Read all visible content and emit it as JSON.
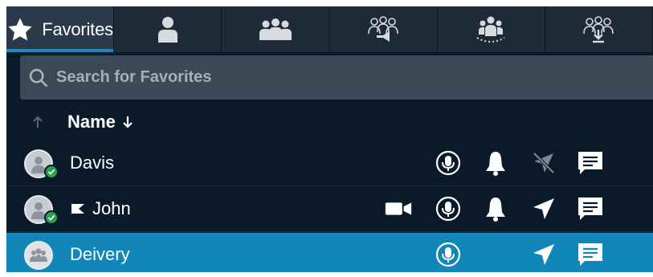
{
  "tabs": [
    {
      "label": "Favorites",
      "icon": "star-icon",
      "active": true
    },
    {
      "label": "",
      "icon": "person-icon"
    },
    {
      "label": "",
      "icon": "group-icon"
    },
    {
      "label": "",
      "icon": "group-broadcast-icon"
    },
    {
      "label": "",
      "icon": "group-talk-icon"
    },
    {
      "label": "",
      "icon": "group-download-icon"
    }
  ],
  "search": {
    "placeholder": "Search for Favorites"
  },
  "list_header": {
    "column_label": "Name"
  },
  "rows": [
    {
      "name": "Davis",
      "presence": "online",
      "icons": [
        "ptt-mic-icon",
        "alert-bell-icon",
        "location-off-icon",
        "message-icon"
      ]
    },
    {
      "name": "John",
      "presence": "online",
      "flagged": true,
      "icons": [
        "video-icon",
        "ptt-mic-icon",
        "alert-bell-icon",
        "location-icon",
        "message-icon"
      ]
    },
    {
      "name": "Deivery",
      "group": true,
      "selected": true,
      "icons": [
        "ptt-mic-icon",
        "location-icon",
        "message-icon"
      ]
    }
  ],
  "colors": {
    "background": "#0b1a28",
    "tab_bar": "#1e2a37",
    "accent": "#1b8bbf",
    "selected_row": "#1087b8",
    "presence_online": "#26a34b"
  }
}
